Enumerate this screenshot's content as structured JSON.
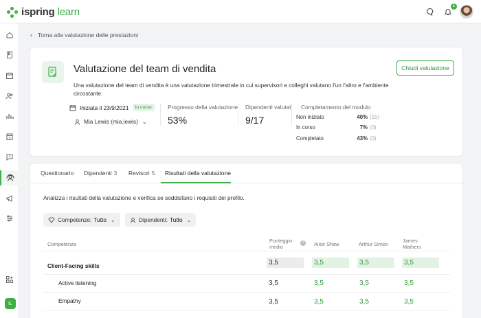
{
  "app": {
    "logo_main": "ispring",
    "logo_accent": "learn",
    "notification_count": "5"
  },
  "breadcrumb": {
    "back_label": "Torna alla valutazione delle prestazioni"
  },
  "header": {
    "title": "Valutazione del team di vendita",
    "close_button": "Chiudi valutazione",
    "description": "Una valutazione del team di vendita è una valutazione trimestrale in cui supervisori e colleghi valutano l'un l'altro e l'ambiente circostante.",
    "started": "Iniziata il 23/9/2021",
    "status": "In corso",
    "owner": "Mia Lewis (mia.lewis)"
  },
  "stats": {
    "progress_label": "Progresso della valutazione",
    "progress_value": "53%",
    "employees_label": "Dipendenti valutati",
    "employees_value": "9/17",
    "module_label": "Completamento del modulo",
    "module_rows": [
      {
        "label": "Non iniziato",
        "value": "40%",
        "count": "(15)"
      },
      {
        "label": "In corso",
        "value": "7%",
        "count": "(0)"
      },
      {
        "label": "Completato",
        "value": "43%",
        "count": "(0)"
      }
    ]
  },
  "tabs": [
    {
      "label": "Questionario",
      "count": ""
    },
    {
      "label": "Dipendenti",
      "count": "3"
    },
    {
      "label": "Revisori",
      "count": "5"
    },
    {
      "label": "Risultati della valutazione",
      "count": ""
    }
  ],
  "results": {
    "intro": "Analizza i risultati della valutazione e verifica se soddisfano i requisiti del profilo.",
    "filters": [
      {
        "label": "Competenze:",
        "value": "Tutto"
      },
      {
        "label": "Dipendenti:",
        "value": "Tutto"
      }
    ],
    "columns": {
      "competence": "Competenza",
      "avg_line1": "Punteggio",
      "avg_line2": "medio",
      "p1": "Alice Shaw",
      "p2": "Arthur Simon",
      "p3_line1": "James",
      "p3_line2": "Mathers"
    },
    "rows": [
      {
        "name": "Client-Facing skills",
        "avg": "3,5",
        "p1": "3,5",
        "p2": "3,5",
        "p3": "3,5"
      },
      {
        "name": "Active listening",
        "avg": "3,5",
        "p1": "3,5",
        "p2": "3,5",
        "p3": "3,5"
      },
      {
        "name": "Empathy",
        "avg": "3,5",
        "p1": "3,5",
        "p2": "3,5",
        "p3": "3,5"
      }
    ]
  },
  "colors": {
    "accent": "#3fae49",
    "accent_text": "#2f9a3c",
    "pill_bg": "#e4f3e6"
  }
}
